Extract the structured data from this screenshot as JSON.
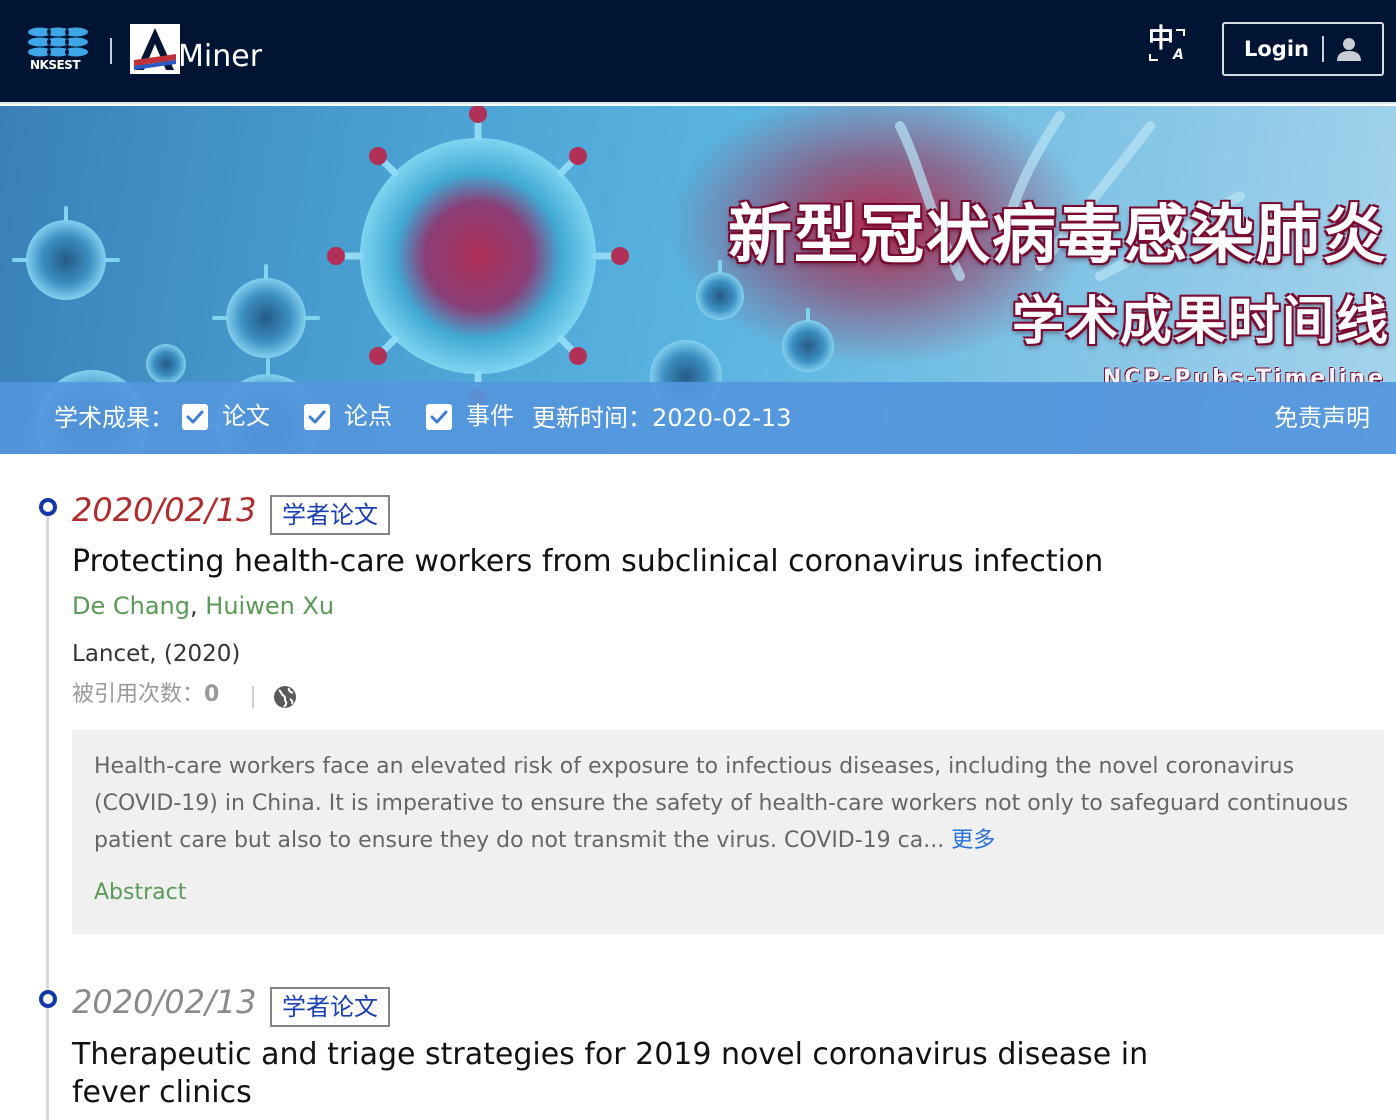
{
  "header": {
    "brand_nk": "NKSEST",
    "brand_aminer": "Miner",
    "lang_zh": "中",
    "lang_a": "A",
    "login_label": "Login"
  },
  "banner": {
    "title": "新型冠状病毒感染肺炎",
    "subtitle": "学术成果时间线",
    "tag": "NCP-Pubs-Timeline"
  },
  "filter": {
    "label": "学术成果：",
    "options": [
      {
        "label": "论文",
        "checked": true
      },
      {
        "label": "论点",
        "checked": true
      },
      {
        "label": "事件",
        "checked": true
      }
    ],
    "update_label": "更新时间：2020-02-13",
    "disclaimer": "免责声明"
  },
  "items": [
    {
      "date": "2020/02/13",
      "tag": "学者论文",
      "title": "Protecting health-care workers from subclinical coronavirus infection",
      "authors": [
        "De Chang",
        "Huiwen Xu"
      ],
      "author_separator": ", ",
      "venue": "Lancet, (2020)",
      "citation_label": "被引用次数：",
      "citation_count": "0",
      "abstract": "Health-care workers face an elevated risk of exposure to infectious diseases, including the novel coronavirus (COVID-19) in China. It is imperative to ensure the safety of health-care workers not only to safeguard continuous patient care but also to ensure they do not transmit the virus. COVID-19 ca...",
      "more_label": "更多",
      "abstract_label": "Abstract"
    },
    {
      "date": "2020/02/13",
      "tag": "学者论文",
      "title": "Therapeutic and triage strategies for 2019 novel coronavirus disease in fever clinics"
    }
  ],
  "colors": {
    "header_bg": "#021433",
    "filter_bg": "#5496dd",
    "date_active": "#b02b2b",
    "date_inactive": "#8a8a8a",
    "timeline_dot": "#1538a8",
    "tag_text": "#1a3fb0",
    "author_green": "#5a9a57",
    "link_blue": "#2a72d8"
  },
  "icons": {
    "nk_logo": "wave-logo-icon",
    "aminer_logo": "aminer-a-logo-icon",
    "language": "translate-icon",
    "user": "user-icon",
    "check": "checkmark-icon",
    "globe": "globe-icon"
  }
}
